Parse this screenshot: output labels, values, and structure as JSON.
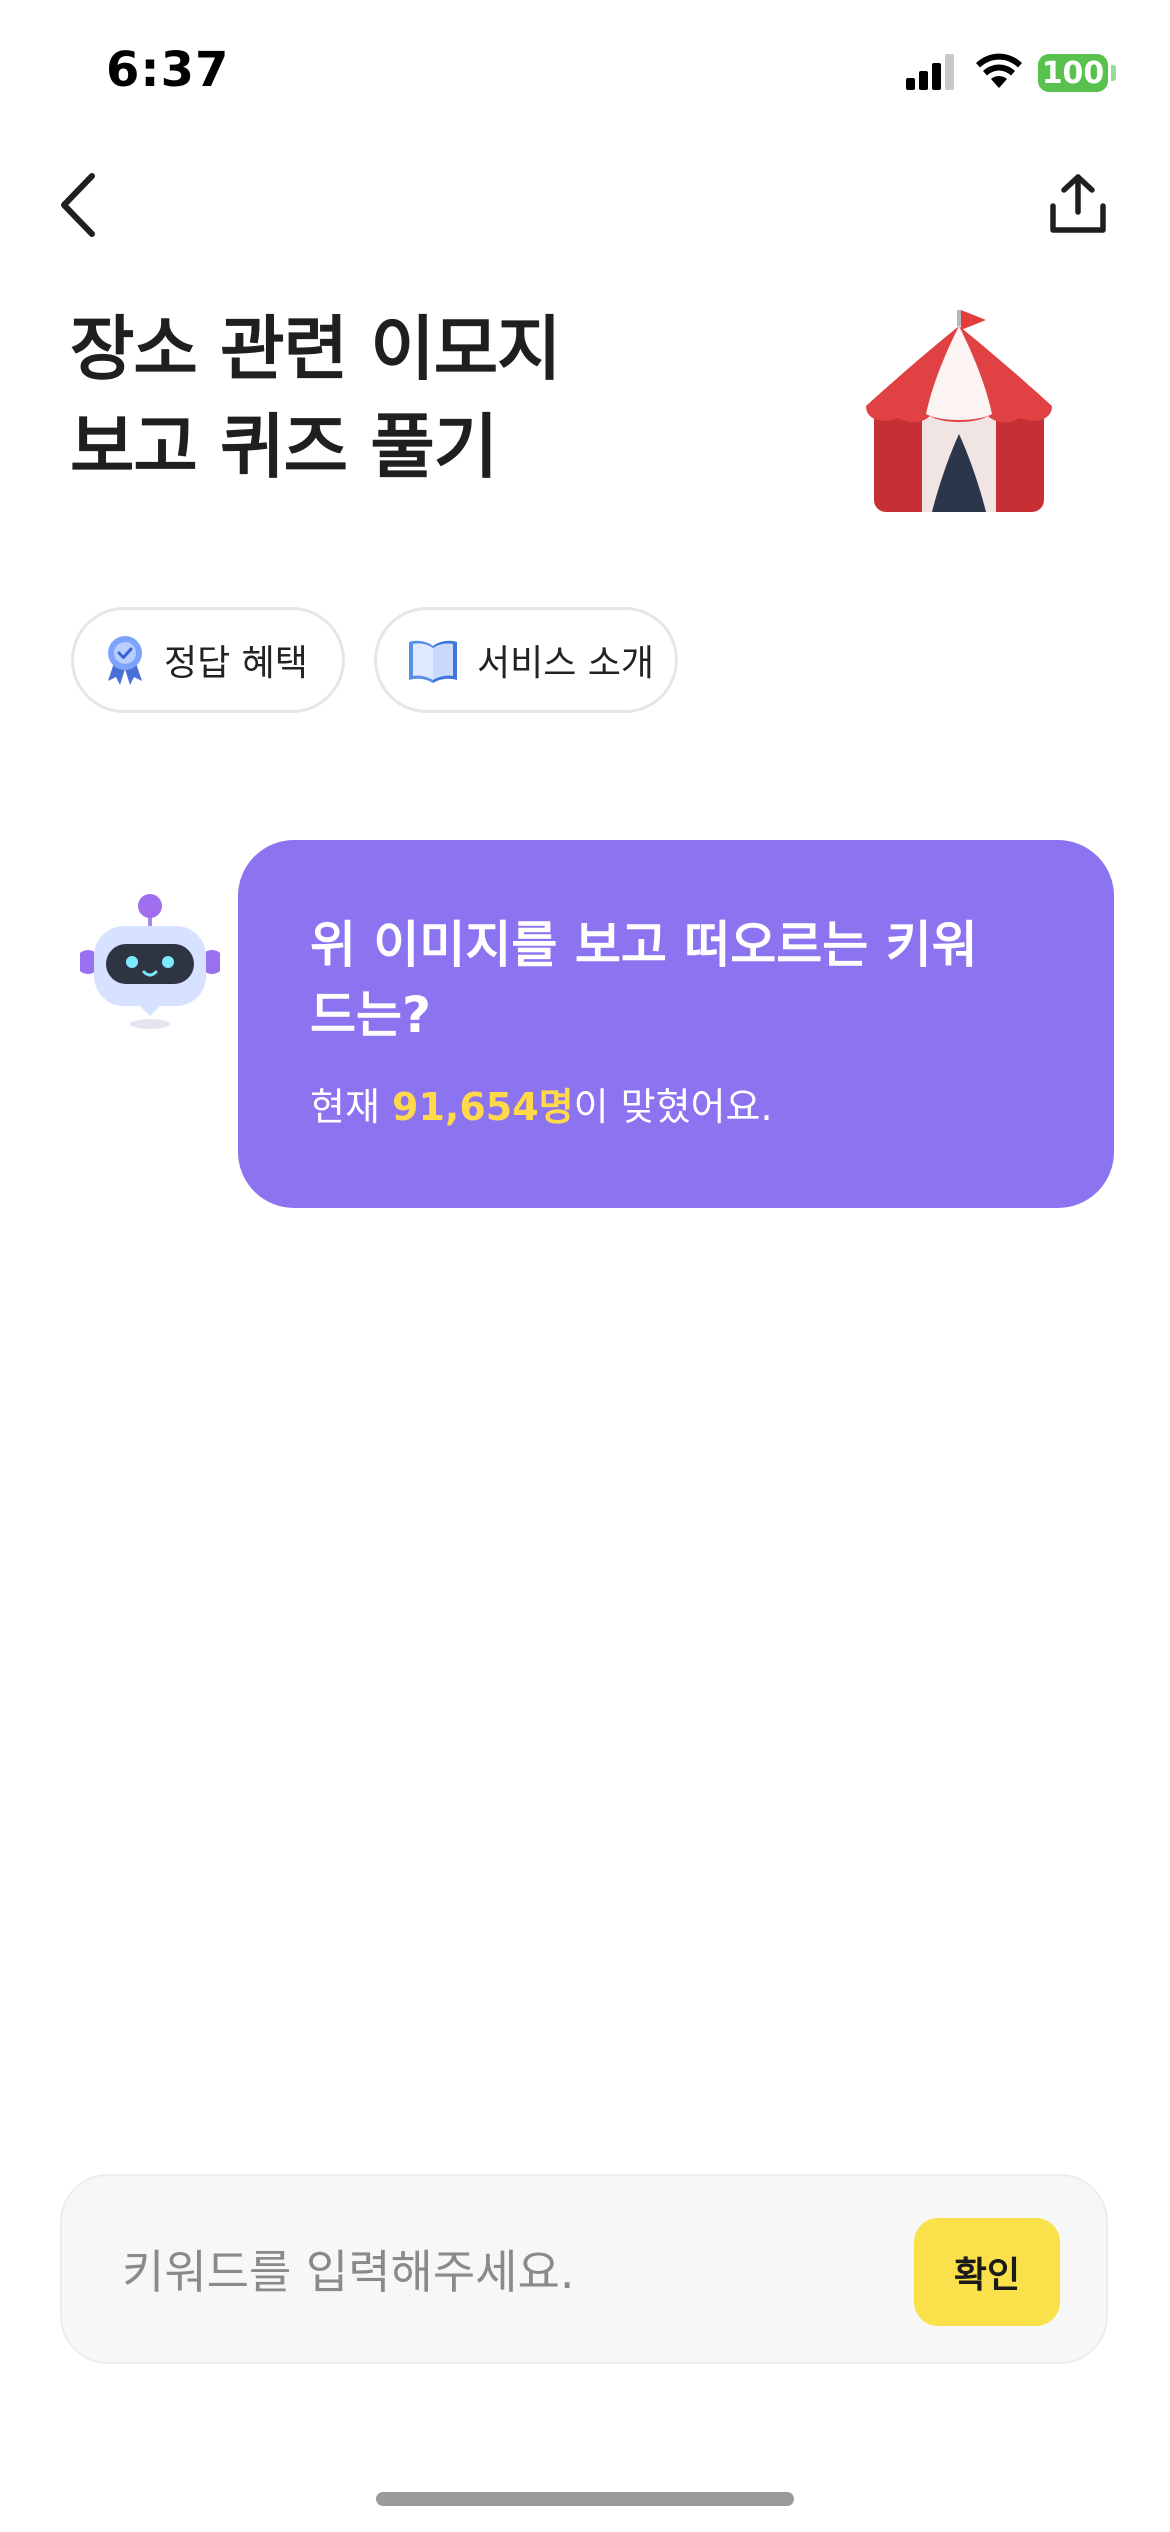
{
  "status_bar": {
    "time": "6:37",
    "battery": "100",
    "icons": [
      "signal-icon",
      "wifi-icon",
      "battery-icon"
    ]
  },
  "nav": {
    "back_icon": "chevron-left-icon",
    "share_icon": "share-upload-icon"
  },
  "title": {
    "line1": "장소 관련 이모지",
    "line2": "보고 퀴즈 풀기",
    "emoji_icon": "circus-tent-icon"
  },
  "chips": [
    {
      "label": "정답 혜택",
      "icon": "award-badge-icon"
    },
    {
      "label": "서비스 소개",
      "icon": "open-book-icon"
    }
  ],
  "bot": {
    "avatar_icon": "robot-icon",
    "question": "위 이미지를 보고 떠오르는 키워드는?",
    "status_prefix": "현재 ",
    "count": "91,654명",
    "status_suffix": "이 맞혔어요."
  },
  "input": {
    "placeholder": "키워드를 입력해주세요.",
    "value": "",
    "confirm_label": "확인"
  },
  "colors": {
    "bubble": "#8c73f0",
    "highlight": "#ffd94a",
    "confirm_button": "#fae04a",
    "battery": "#59c24f",
    "tent_red": "#d8383a"
  }
}
